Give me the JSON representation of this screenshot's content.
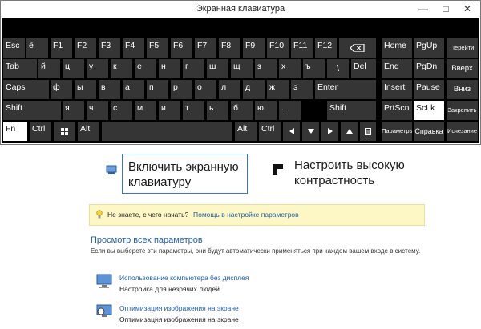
{
  "window": {
    "title": "Экранная клавиатура",
    "minimize_glyph": "—",
    "maximize_glyph": "□",
    "close_glyph": "✕"
  },
  "keyboard": {
    "row_function": [
      {
        "label": "Esc",
        "name": "key-esc"
      },
      {
        "label": "ё",
        "name": "key-yo"
      },
      {
        "label": "F1",
        "name": "key-f1"
      },
      {
        "label": "F2",
        "name": "key-f2"
      },
      {
        "label": "F3",
        "name": "key-f3"
      },
      {
        "label": "F4",
        "name": "key-f4"
      },
      {
        "label": "F5",
        "name": "key-f5"
      },
      {
        "label": "F6",
        "name": "key-f6"
      },
      {
        "label": "F7",
        "name": "key-f7"
      },
      {
        "label": "F8",
        "name": "key-f8"
      },
      {
        "label": "F9",
        "name": "key-f9"
      },
      {
        "label": "F10",
        "name": "key-f10"
      },
      {
        "label": "F11",
        "name": "key-f11"
      },
      {
        "label": "F12",
        "name": "key-f12"
      }
    ],
    "backspace": {
      "icon": "backspace-icon"
    },
    "row_letters1": [
      "й",
      "ц",
      "у",
      "к",
      "е",
      "н",
      "г",
      "ш",
      "щ",
      "з",
      "х",
      "ъ"
    ],
    "row_letters2": [
      "ф",
      "ы",
      "в",
      "а",
      "п",
      "р",
      "о",
      "л",
      "д",
      "ж",
      "э"
    ],
    "row_letters3": [
      "я",
      "ч",
      "с",
      "м",
      "и",
      "т",
      "ь",
      "б",
      "ю",
      "."
    ],
    "tab_label": "Tab",
    "caps_label": "Caps",
    "shift_label": "Shift",
    "enter_label": "Enter",
    "del_label": "Del",
    "fn_label": "Fn",
    "ctrl_label": "Ctrl",
    "alt_label": "Alt",
    "nav": {
      "home": "Home",
      "pgup": "PgUp",
      "end": "End",
      "pgdn": "PgDn",
      "insert": "Insert",
      "pause": "Pause",
      "prtscn": "PrtScn",
      "sclk": "ScLk",
      "options": "Параметры",
      "help": "Справка"
    },
    "side": {
      "jump": "Перейти",
      "up": "Вверх",
      "down": "Вниз",
      "dock": "Закрепить",
      "fade": "Исчезание"
    },
    "lit_keys": [
      "Fn",
      "ScLk"
    ]
  },
  "page": {
    "tile_osk_label": "Включить экранную клавиатуру",
    "tile_contrast_label": "Настроить высокую контрастность",
    "hint_question": "Не знаете, с чего начать?",
    "hint_link": "Помощь в настройке параметров",
    "section_title": "Просмотр всех параметров",
    "section_desc": "Если вы выберете эти параметры, они будут автоматически применяться при каждом вашем входе в систему.",
    "options": [
      {
        "link": "Использование компьютера без дисплея",
        "sub": "Настройка для незрячих людей"
      },
      {
        "link": "Оптимизация изображения на экране",
        "sub": "Оптимизация изображения на экране"
      }
    ]
  },
  "colors": {
    "key_bg": "#353535",
    "key_lit_bg": "#ffffff",
    "keyboard_bg": "#000000",
    "link": "#1f5fa8",
    "hint_bg": "#fdf7c6",
    "tile_border": "#3a78c2"
  }
}
